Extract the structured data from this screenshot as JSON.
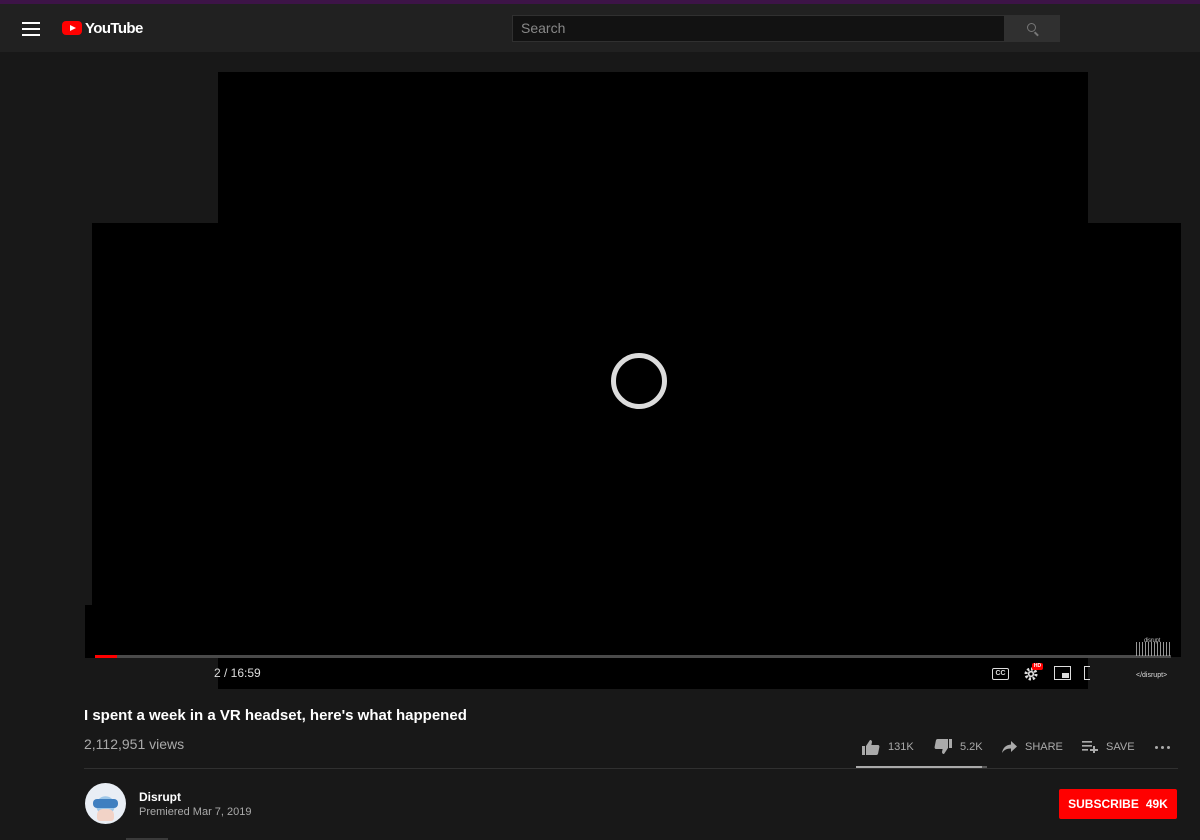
{
  "header": {
    "logo_text": "YouTube",
    "search_placeholder": "Search",
    "menu_icon": "hamburger-menu-icon",
    "search_icon": "magnifier-icon"
  },
  "player": {
    "state": "buffering",
    "time_display": "2 / 16:59",
    "progress_fraction": 0.02,
    "controls": [
      "cc-icon",
      "settings-gear-icon",
      "miniplayer-icon",
      "fullscreen-icon"
    ],
    "hd_badge": "HD",
    "cc_label": "CC",
    "watermark_text": "disrupt",
    "channel_tag": "</disrupt>"
  },
  "video": {
    "title": "I spent a week in a VR headset, here's what happened",
    "views": "2,112,951 views",
    "likes": "131K",
    "dislikes": "5.2K",
    "like_ratio": 0.962,
    "share_label": "SHARE",
    "save_label": "SAVE"
  },
  "channel": {
    "name": "Disrupt",
    "premiered": "Premiered Mar 7, 2019",
    "subscribe_label": "SUBSCRIBE",
    "subscriber_count": "49K"
  },
  "colors": {
    "brand_red": "#ff0000",
    "background": "#181818",
    "masthead": "#212121",
    "secondary_text": "#aaaaaa"
  }
}
